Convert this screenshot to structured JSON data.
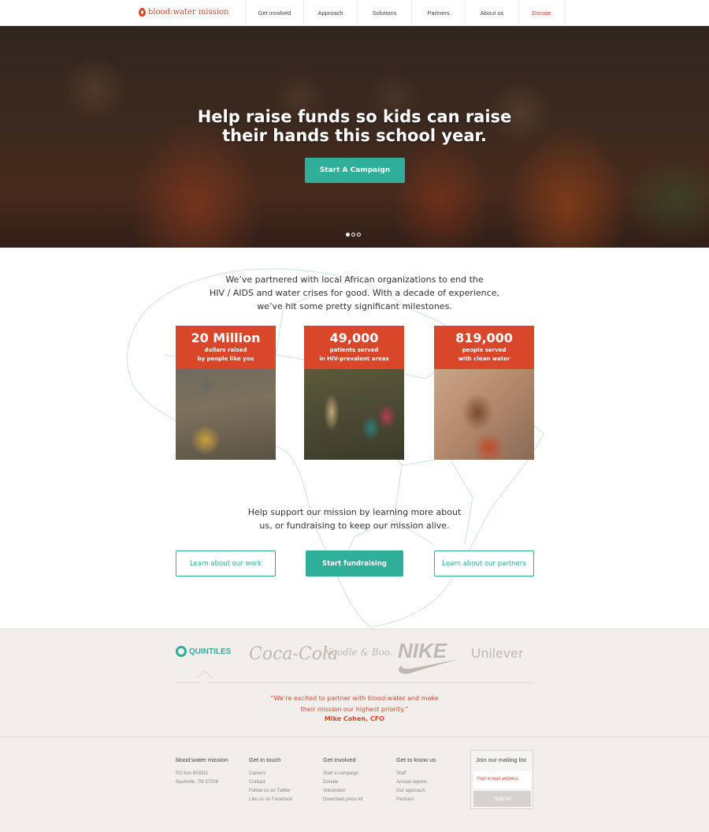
{
  "nav": {
    "logo_text": "blood:water mission",
    "items": [
      {
        "label": "Get involved"
      },
      {
        "label": "Approach"
      },
      {
        "label": "Solutions"
      },
      {
        "label": "Partners"
      },
      {
        "label": "About us"
      },
      {
        "label": "Donate"
      }
    ]
  },
  "hero": {
    "title_line1": "Help raise funds so kids can raise",
    "title_line2": "their hands this school year.",
    "cta": "Start A Campaign",
    "slide_count": 3,
    "active_slide": 1
  },
  "intro": {
    "line1": "We’ve partnered with local African organizations to end the",
    "line2": "HIV / AIDS and water crises for good. With a decade of experience,",
    "line3": "we’ve hit some pretty significant milestones."
  },
  "stats": [
    {
      "value": "20 Million",
      "label1": "dollars raised",
      "label2": "by people like you"
    },
    {
      "value": "49,000",
      "label1": "patients served",
      "label2": "in HIV-prevalent areas"
    },
    {
      "value": "819,000",
      "label1": "people served",
      "label2": "with clean water"
    }
  ],
  "support": {
    "line1": "Help support our mission by learning more about",
    "line2": "us, or fundraising to keep our mission alive."
  },
  "buttons": {
    "learn_work": "Learn about our work",
    "fundraise": "Start fundraising",
    "learn_partners": "Learn about our partners"
  },
  "partners": {
    "logos": [
      "QUINTILES",
      "Coca-Cola",
      "Noodle & Boo.",
      "NIKE",
      "Unilever"
    ],
    "quote_line1": "“We’re excited to partner with blood:water and make",
    "quote_line2": "their mission our highest priority.”",
    "quote_by": "Mike Cohen, CFO"
  },
  "footer": {
    "org": {
      "name": "blood:water mission",
      "address1": "PO box 603811",
      "address2": "Nashville, TN 37206"
    },
    "columns": [
      {
        "heading": "Get in touch",
        "links": [
          "Careers",
          "Contact",
          "Follow us on Twitter",
          "Like us on Facebook"
        ]
      },
      {
        "heading": "Get involved",
        "links": [
          "Start a campaign",
          "Donate",
          "Volounteer",
          "Download press kit"
        ]
      },
      {
        "heading": "Get to know us",
        "links": [
          "Staff",
          "Annual reports",
          "Our approach",
          "Partners"
        ]
      }
    ],
    "mailing": {
      "heading": "Join our mailing list",
      "placeholder": "Your e-mail address",
      "submit": "Submit"
    }
  },
  "colors": {
    "brand_red": "#d9472b",
    "accent_teal": "#2fae9a",
    "partner_bg": "#f1eeec"
  }
}
